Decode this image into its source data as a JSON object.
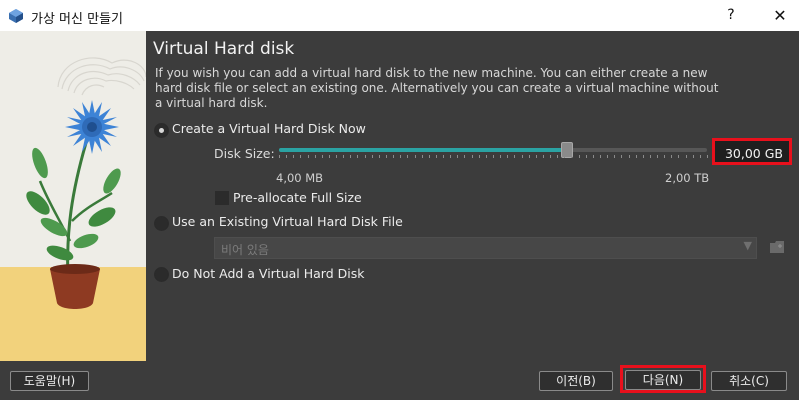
{
  "window": {
    "title": "가상 머신 만들기",
    "help_glyph": "?",
    "close_glyph": "✕"
  },
  "page": {
    "heading": "Virtual Hard disk",
    "description": "If you wish you can add a virtual hard disk to the new machine. You can either create a new hard disk file or select an existing one. Alternatively you can create a virtual machine without a virtual hard disk."
  },
  "options": {
    "create_new": {
      "label": "Create a Virtual Hard Disk Now",
      "selected": true
    },
    "use_existing": {
      "label": "Use an Existing Virtual Hard Disk File",
      "selected": false
    },
    "no_disk": {
      "label": "Do Not Add a Virtual Hard Disk",
      "selected": false
    }
  },
  "disk_size": {
    "label": "Disk Size:",
    "value_text": "30,00 GB",
    "min_label": "4,00 MB",
    "max_label": "2,00 TB",
    "slider_fraction": 0.67
  },
  "preallocate": {
    "label": "Pre-allocate Full Size",
    "checked": false
  },
  "existing_file": {
    "placeholder": "비어 있음",
    "icon": "folder-icon"
  },
  "buttons": {
    "help": "도움말(H)",
    "back": "이전(B)",
    "next": "다음(N)",
    "cancel": "취소(C)"
  },
  "colors": {
    "accent_highlight": "#e8101c",
    "slider_fill": "#2aa3a3"
  }
}
